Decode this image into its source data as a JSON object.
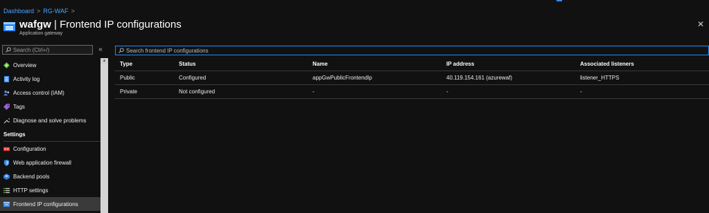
{
  "breadcrumb": {
    "items": [
      "Dashboard",
      "RG-WAF"
    ],
    "separator": ">"
  },
  "header": {
    "resource_name": "wafgw",
    "page_name": "| Frontend IP configurations",
    "subtitle": "Application gateway",
    "close_glyph": "✕"
  },
  "sidebar": {
    "search_placeholder": "Search (Ctrl+/)",
    "collapse_glyph": "«",
    "items_top": [
      {
        "label": "Overview",
        "icon": "overview-icon"
      },
      {
        "label": "Activity log",
        "icon": "activity-log-icon"
      },
      {
        "label": "Access control (IAM)",
        "icon": "iam-icon"
      },
      {
        "label": "Tags",
        "icon": "tag-icon"
      },
      {
        "label": "Diagnose and solve problems",
        "icon": "wrench-icon"
      }
    ],
    "section_settings": "Settings",
    "items_settings": [
      {
        "label": "Configuration",
        "icon": "configuration-icon"
      },
      {
        "label": "Web application firewall",
        "icon": "shield-icon"
      },
      {
        "label": "Backend pools",
        "icon": "backend-pool-icon"
      },
      {
        "label": "HTTP settings",
        "icon": "settings-list-icon"
      },
      {
        "label": "Frontend IP configurations",
        "icon": "frontend-ip-icon",
        "active": true
      }
    ]
  },
  "main": {
    "search_placeholder": "Search frontend IP configurations",
    "columns": [
      "Type",
      "Status",
      "Name",
      "IP address",
      "Associated listeners"
    ],
    "rows": [
      [
        "Public",
        "Configured",
        "appGwPublicFrontendIp",
        "40.119.154.161 (azurewaf)",
        "listener_HTTPS"
      ],
      [
        "Private",
        "Not configured",
        "-",
        "-",
        "-"
      ]
    ]
  },
  "colors": {
    "accent": "#2f8fff",
    "link": "#4aa6ff",
    "background": "#111111",
    "active_item": "#3a3a3a"
  }
}
